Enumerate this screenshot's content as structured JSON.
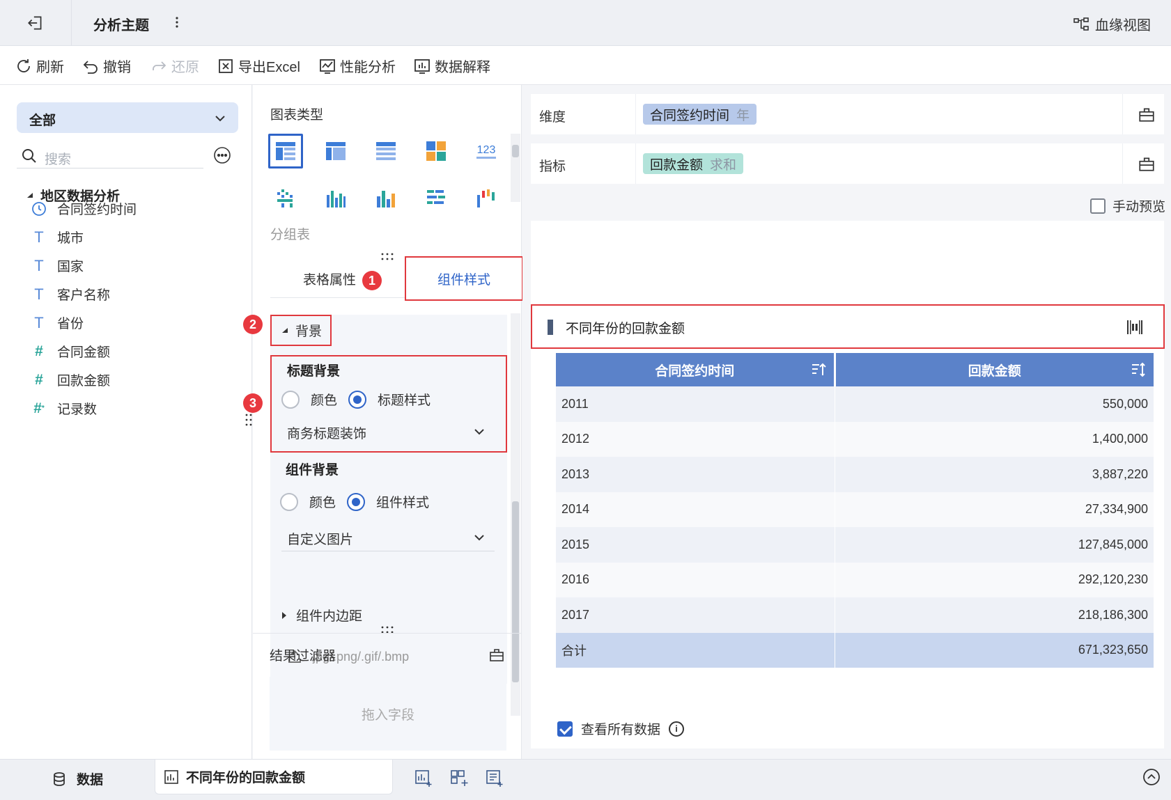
{
  "header": {
    "title": "分析主题",
    "lineage_label": "血缘视图"
  },
  "toolbar": {
    "refresh": "刷新",
    "undo": "撤销",
    "redo": "还原",
    "export": "导出Excel",
    "performance": "性能分析",
    "explain": "数据解释"
  },
  "left": {
    "scope": "全部",
    "search_placeholder": "搜索",
    "folder": "地区数据分析",
    "fields": [
      {
        "name": "合同签约时间",
        "type": "date-icon"
      },
      {
        "name": "城市",
        "type": "text-icon"
      },
      {
        "name": "国家",
        "type": "text-icon"
      },
      {
        "name": "客户名称",
        "type": "text-icon"
      },
      {
        "name": "省份",
        "type": "text-icon"
      },
      {
        "name": "合同金额",
        "type": "number-icon"
      },
      {
        "name": "回款金额",
        "type": "number-icon"
      },
      {
        "name": "记录数",
        "type": "count-icon"
      }
    ]
  },
  "middle": {
    "chart_type_title": "图表类型",
    "chart_type_name": "分组表",
    "tabs": [
      "表格属性",
      "组件样式"
    ],
    "badges": [
      "1",
      "2",
      "3"
    ],
    "background_section": "背景",
    "title_bg": {
      "heading": "标题背景",
      "options": [
        "颜色",
        "标题样式"
      ],
      "selected": "标题样式",
      "select_value": "商务标题装饰"
    },
    "component_bg": {
      "heading": "组件背景",
      "options": [
        "颜色",
        "组件样式"
      ],
      "selected": "组件样式",
      "select_value": "自定义图片",
      "upload_hint": ".jpg/.png/.gif/.bmp"
    },
    "padding_section": "组件内边距",
    "filter": {
      "title": "结果过滤器",
      "placeholder": "拖入字段"
    }
  },
  "right": {
    "dimension_label": "维度",
    "dimension_pill": {
      "name": "合同签约时间",
      "agg": "年"
    },
    "measure_label": "指标",
    "measure_pill": {
      "name": "回款金额",
      "agg": "求和"
    },
    "manual_preview": "手动预览",
    "component_title": "不同年份的回款金额",
    "table": {
      "headers": [
        "合同签约时间",
        "回款金额"
      ],
      "rows": [
        [
          "2011",
          "550,000"
        ],
        [
          "2012",
          "1,400,000"
        ],
        [
          "2013",
          "3,887,220"
        ],
        [
          "2014",
          "27,334,900"
        ],
        [
          "2015",
          "127,845,000"
        ],
        [
          "2016",
          "292,120,230"
        ],
        [
          "2017",
          "218,186,300"
        ]
      ],
      "total": [
        "合计",
        "671,323,650"
      ]
    },
    "view_all": "查看所有数据"
  },
  "bottom": {
    "data_tab": "数据",
    "component_tab": "不同年份的回款金额"
  },
  "colors": {
    "accent": "#2f64c8",
    "highlight_border": "#e0383d",
    "table_header": "#5b82c9",
    "dimension_pill": "#b7c9ea",
    "measure_pill": "#b2e3da"
  }
}
